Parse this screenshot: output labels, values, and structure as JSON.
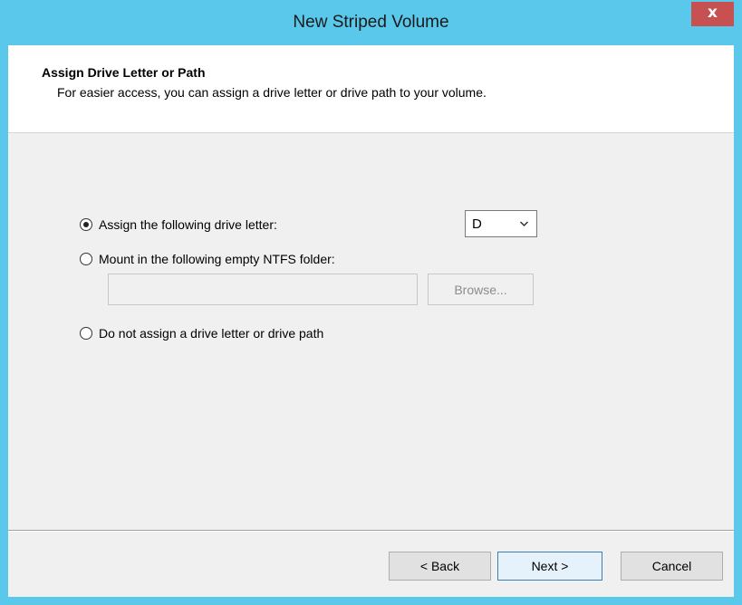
{
  "window": {
    "title": "New Striped Volume",
    "close_glyph": "x",
    "colors": {
      "titlebar": "#5ac8ea",
      "close_button": "#c75050",
      "client_bg": "#f0f0f0"
    }
  },
  "header": {
    "title": "Assign Drive Letter or Path",
    "subtitle": "For easier access, you can assign a drive letter or drive path to your volume."
  },
  "options": {
    "assign_letter": {
      "label": "Assign the following drive letter:",
      "checked": true
    },
    "mount_folder": {
      "label": "Mount in the following empty NTFS folder:",
      "checked": false
    },
    "no_assign": {
      "label": "Do not assign a drive letter or drive path",
      "checked": false
    }
  },
  "drive_select": {
    "value": "D",
    "icon": "chevron-down-icon"
  },
  "folder_input": {
    "value": ""
  },
  "browse_button": {
    "label": "Browse..."
  },
  "footer": {
    "back_label": "< Back",
    "next_label": "Next >",
    "cancel_label": "Cancel"
  }
}
